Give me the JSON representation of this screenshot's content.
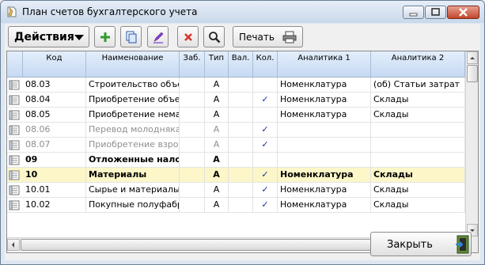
{
  "window": {
    "title": "План счетов бухгалтерского учета"
  },
  "toolbar": {
    "actions_label": "Действия",
    "print_label": "Печать",
    "buttons": [
      "add-icon",
      "copy-icon",
      "edit-icon",
      "delete-icon",
      "search-icon"
    ]
  },
  "table": {
    "columns": [
      "Код",
      "Наименование",
      "Заб.",
      "Тип",
      "Вал.",
      "Кол.",
      "Аналитика 1",
      "Аналитика 2"
    ],
    "rows": [
      {
        "code": "08.03",
        "name": "Строительство объе",
        "zab": "",
        "type": "А",
        "val": "",
        "kol": "",
        "a1": "Номенклатура",
        "a2": "(об) Статьи затрат",
        "style": ""
      },
      {
        "code": "08.04",
        "name": "Приобретение объе",
        "zab": "",
        "type": "А",
        "val": "",
        "kol": "✓",
        "a1": "Номенклатура",
        "a2": "Склады",
        "style": ""
      },
      {
        "code": "08.05",
        "name": "Приобретение нема",
        "zab": "",
        "type": "А",
        "val": "",
        "kol": "",
        "a1": "Номенклатура",
        "a2": "Склады",
        "style": ""
      },
      {
        "code": "08.06",
        "name": "Перевод молоднякa",
        "zab": "",
        "type": "А",
        "val": "",
        "kol": "✓",
        "a1": "",
        "a2": "",
        "style": "grey"
      },
      {
        "code": "08.07",
        "name": "Приобретение взро",
        "zab": "",
        "type": "А",
        "val": "",
        "kol": "✓",
        "a1": "",
        "a2": "",
        "style": "grey"
      },
      {
        "code": "09",
        "name": "Отложенные нало",
        "zab": "",
        "type": "А",
        "val": "",
        "kol": "",
        "a1": "",
        "a2": "",
        "style": "bold"
      },
      {
        "code": "10",
        "name": "Материалы",
        "zab": "",
        "type": "А",
        "val": "",
        "kol": "✓",
        "a1": "Номенклатура",
        "a2": "Склады",
        "style": "bold sel"
      },
      {
        "code": "10.01",
        "name": "Сырье и материалы",
        "zab": "",
        "type": "А",
        "val": "",
        "kol": "✓",
        "a1": "Номенклатура",
        "a2": "Склады",
        "style": ""
      },
      {
        "code": "10.02",
        "name": "Покупные полуфабр",
        "zab": "",
        "type": "А",
        "val": "",
        "kol": "✓",
        "a1": "Номенклатура",
        "a2": "Склады",
        "style": ""
      }
    ]
  },
  "footer": {
    "close_label": "Закрыть"
  },
  "colors": {
    "check": "#1a2f9a",
    "selected_row": "#fcf6c8",
    "header": "#c6daf2"
  }
}
